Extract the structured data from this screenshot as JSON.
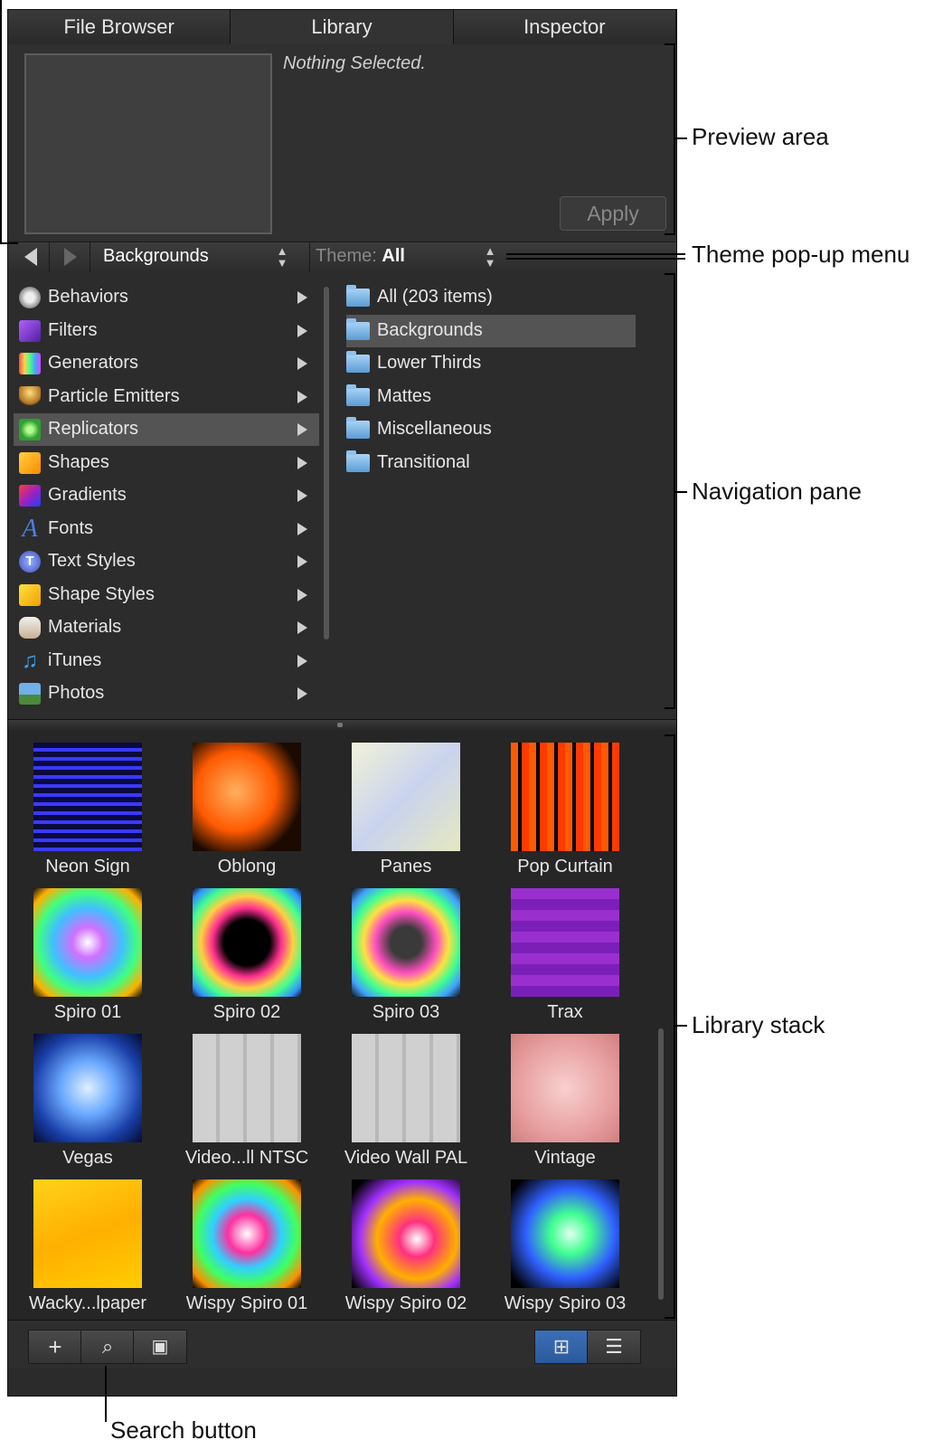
{
  "tabs": [
    {
      "label": "File Browser"
    },
    {
      "label": "Library"
    },
    {
      "label": "Inspector"
    }
  ],
  "preview": {
    "status": "Nothing Selected.",
    "apply_label": "Apply"
  },
  "navbar": {
    "category": "Backgrounds",
    "theme_label": "Theme:",
    "theme_value": "All"
  },
  "categories": [
    {
      "label": "Behaviors",
      "icon": "gear-icon",
      "color": "#cfcfcf"
    },
    {
      "label": "Filters",
      "icon": "filters-icon",
      "color": "#8a3fd6"
    },
    {
      "label": "Generators",
      "icon": "generators-icon",
      "color": "#d24aa8"
    },
    {
      "label": "Particle Emitters",
      "icon": "particle-emitters-icon",
      "color": "#d9a33a"
    },
    {
      "label": "Replicators",
      "icon": "replicators-icon",
      "color": "#4fc44a"
    },
    {
      "label": "Shapes",
      "icon": "shapes-icon",
      "color": "#f0a32c"
    },
    {
      "label": "Gradients",
      "icon": "gradients-icon",
      "color": "#b52a6a"
    },
    {
      "label": "Fonts",
      "icon": "fonts-icon",
      "color": "#3a6fd8"
    },
    {
      "label": "Text Styles",
      "icon": "text-styles-icon",
      "color": "#4c6fd0"
    },
    {
      "label": "Shape Styles",
      "icon": "shape-styles-icon",
      "color": "#f3c21e"
    },
    {
      "label": "Materials",
      "icon": "materials-icon",
      "color": "#d9b38c"
    },
    {
      "label": "iTunes",
      "icon": "music-note-icon",
      "color": "#3a9ef0"
    },
    {
      "label": "Photos",
      "icon": "photos-icon",
      "color": "#5aa0d8"
    }
  ],
  "folders": [
    {
      "label": "All (203 items)"
    },
    {
      "label": "Backgrounds"
    },
    {
      "label": "Lower Thirds"
    },
    {
      "label": "Mattes"
    },
    {
      "label": "Miscellaneous"
    },
    {
      "label": "Transitional"
    }
  ],
  "items": [
    {
      "label": "Neon Sign",
      "bg": "repeating-linear-gradient(#0a0a40 0 6px, #3a3aff 6px 10px)"
    },
    {
      "label": "Oblong",
      "bg": "radial-gradient(circle at 40% 45%, #ffb060, #ff5a00 45%, #1a0a00 75%)"
    },
    {
      "label": "Panes",
      "bg": "linear-gradient(135deg, #f2f2d8, #c9d3ee 50%, #e6e8c0)"
    },
    {
      "label": "Pop Curtain",
      "bg": "repeating-linear-gradient(90deg, #ff5a00 0 8px, #000 8px 12px, #ff3a00 12px 20px)"
    },
    {
      "label": "Spiro 01",
      "bg": "radial-gradient(circle, #fff 0%, #d070ff 20%, #40c0ff 45%, #40ff80 65%, #ffb000 85%, #101010 100%)"
    },
    {
      "label": "Spiro 02",
      "bg": "radial-gradient(circle, #000 30%, #ff3090 45%, #ffd040 60%, #40ff90 75%, #3090ff 90%, #101010 100%)"
    },
    {
      "label": "Spiro 03",
      "bg": "radial-gradient(circle, #3a3a3a 20%, #ff50c0 40%, #ffe040 55%, #40ff90 70%, #40a0ff 85%, #101010 100%)"
    },
    {
      "label": "Trax",
      "bg": "repeating-linear-gradient(#9a2fd0 0 12px, #7b1fb8 12px 24px)"
    },
    {
      "label": "Vegas",
      "bg": "radial-gradient(circle, #dff0ff 0%, #6aa8ff 35%, #1a3fa8 70%, #050a30 100%)"
    },
    {
      "label": "Video...ll NTSC",
      "bg": "repeating-linear-gradient(90deg, #d0d0d0 0 26px, #b8b8b8 26px 30px)"
    },
    {
      "label": "Video Wall PAL",
      "bg": "repeating-linear-gradient(90deg, #d0d0d0 0 26px, #b8b8b8 26px 30px)"
    },
    {
      "label": "Vintage",
      "bg": "radial-gradient(circle, #f8d0d0 0%, #e8a0a0 60%, #d08080 100%)"
    },
    {
      "label": "Wacky...lpaper",
      "bg": "linear-gradient(160deg, #ffd21a, #ffb000 50%, #ffcc00)"
    },
    {
      "label": "Wispy Spiro 01",
      "bg": "radial-gradient(circle, #ffffff 0%, #ff30a0 25%, #30d0ff 45%, #40ff60 65%, #ff9000 85%, #000 100%)"
    },
    {
      "label": "Wispy Spiro 02",
      "bg": "radial-gradient(circle at 60% 55%, #ffffff 0%, #ff3080 20%, #ffb000 45%, #a030ff 65%, #000 90%)"
    },
    {
      "label": "Wispy Spiro 03",
      "bg": "radial-gradient(circle at 55% 50%, #e0fff0 0%, #40ff90 25%, #3060ff 55%, #000 90%)"
    }
  ],
  "bottombar": {
    "add_label": "+",
    "search_label": "⌕",
    "preview_toggle_label": "▣",
    "icon_view_label": "⊞",
    "list_view_label": "☰"
  },
  "annotations": {
    "preview_area": "Preview area",
    "theme_popup": "Theme pop-up menu",
    "navigation_pane": "Navigation pane",
    "library_stack": "Library stack",
    "search_button": "Search button"
  }
}
